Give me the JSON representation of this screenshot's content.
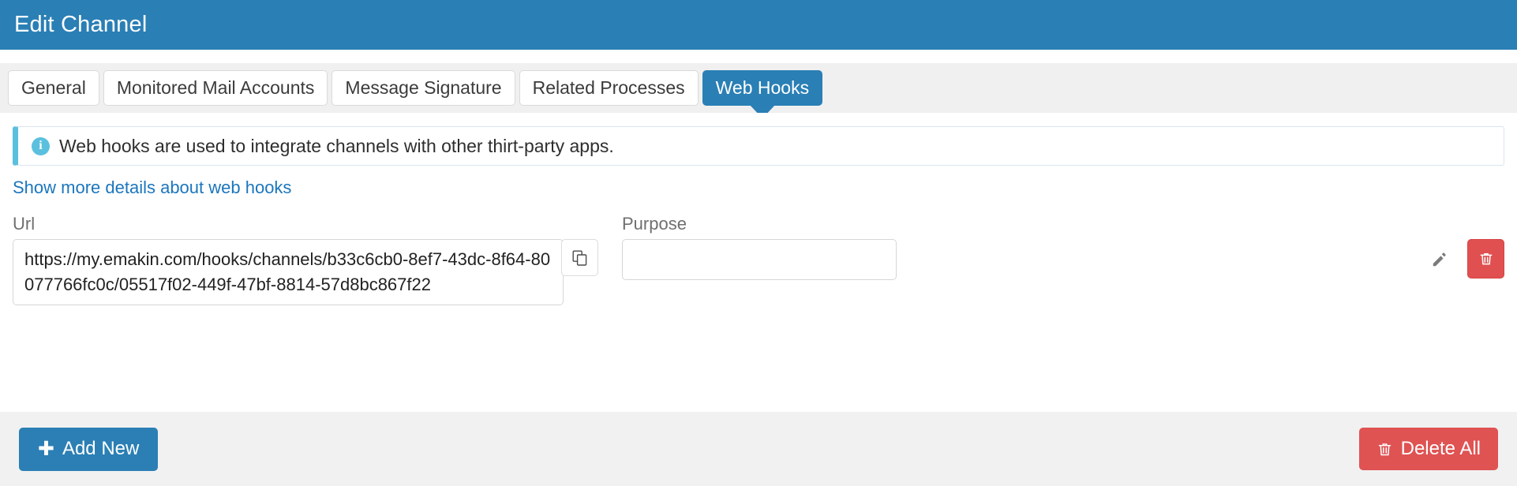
{
  "header": {
    "title": "Edit Channel",
    "background_color": "#2a7fb5"
  },
  "tabs": [
    {
      "label": "General",
      "active": false
    },
    {
      "label": "Monitored Mail Accounts",
      "active": false
    },
    {
      "label": "Message Signature",
      "active": false
    },
    {
      "label": "Related Processes",
      "active": false
    },
    {
      "label": "Web Hooks",
      "active": true
    }
  ],
  "alert": {
    "icon": "info-circle-icon",
    "text": "Web hooks are used to integrate channels with other thirt-party apps.",
    "accent_color": "#5bc0de"
  },
  "details_link": {
    "label": "Show more details about web hooks",
    "color": "#1b76bc"
  },
  "form": {
    "url": {
      "label": "Url",
      "value": "https://my.emakin.com/hooks/channels/b33c6cb0-8ef7-43dc-8f64-80077766fc0c/05517f02-449f-47bf-8814-57d8bc867f22",
      "copy_icon": "copy-icon"
    },
    "purpose": {
      "label": "Purpose",
      "value": "",
      "placeholder": "",
      "edit_icon": "pencil-icon"
    },
    "row_delete": {
      "icon": "trash-icon",
      "color": "#e05050"
    }
  },
  "footer": {
    "add_new": {
      "label": "Add New",
      "icon": "plus-icon",
      "color": "#2b7fb5"
    },
    "delete_all": {
      "label": "Delete All",
      "icon": "trash-icon",
      "color": "#df5353"
    }
  }
}
